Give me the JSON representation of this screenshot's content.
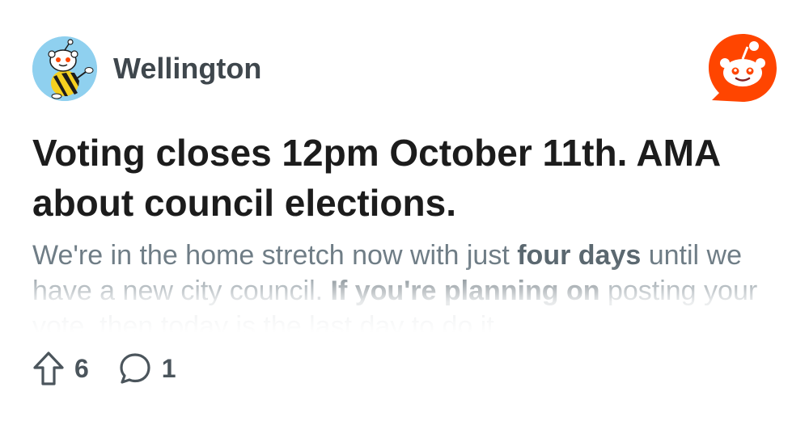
{
  "community": {
    "name": "Wellington",
    "avatar_icon": "community-mascot-icon"
  },
  "brand": {
    "icon": "reddit-logo-icon",
    "color": "#ff4500"
  },
  "post": {
    "title": "Voting closes 12pm October 11th. AMA about council elections.",
    "body": {
      "part1": "We're in the home stretch now with just ",
      "bold1": "four days",
      "part2": " until we have a new city council. ",
      "bold2": "If you're planning on",
      "part3": " posting your vote, then today is the last day to do it"
    }
  },
  "actions": {
    "upvotes": "6",
    "comments": "1",
    "upvote_icon": "upvote-arrow-icon",
    "comment_icon": "comment-bubble-icon"
  }
}
